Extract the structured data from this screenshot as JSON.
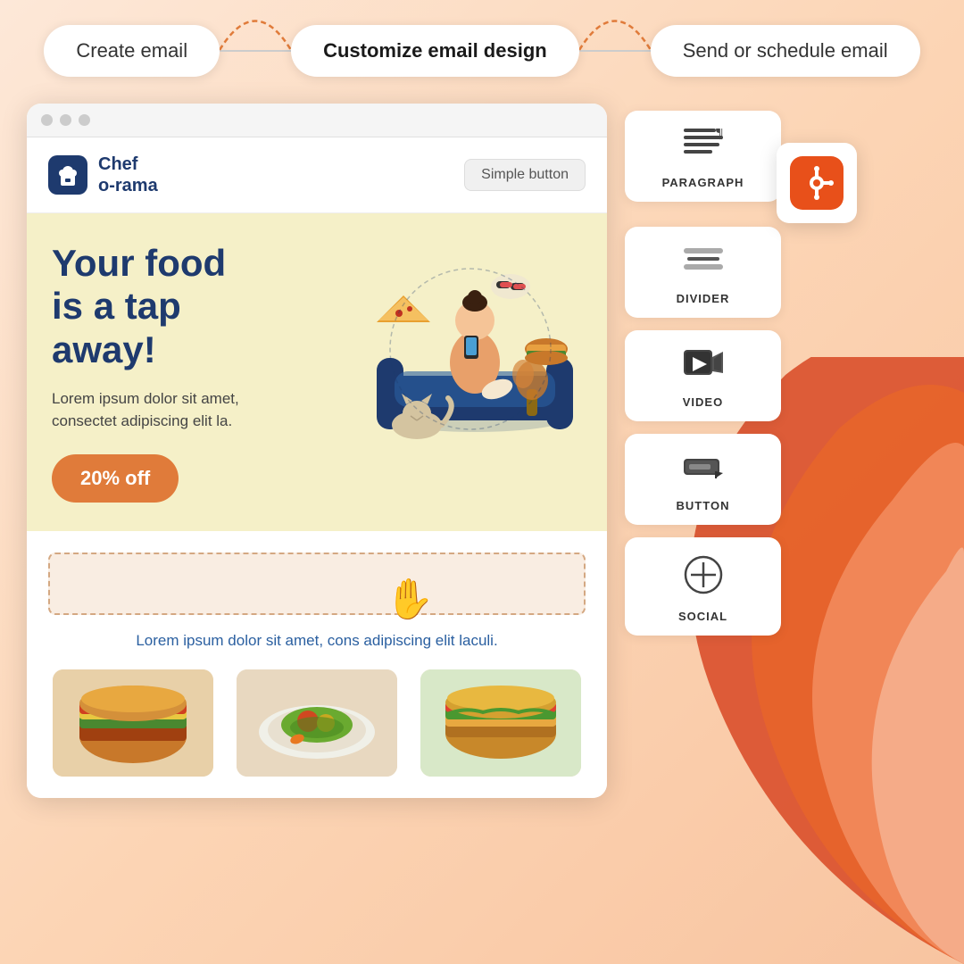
{
  "workflow": {
    "steps": [
      {
        "id": "create",
        "label": "Create email",
        "active": false
      },
      {
        "id": "customize",
        "label": "Customize email design",
        "active": true
      },
      {
        "id": "send",
        "label": "Send or schedule email",
        "active": false
      }
    ]
  },
  "email_preview": {
    "browser_dots": [
      "dot1",
      "dot2",
      "dot3"
    ],
    "brand": {
      "name_line1": "Chef",
      "name_line2": "o-rama"
    },
    "simple_button_label": "Simple button",
    "hero": {
      "title_line1": "Your food",
      "title_line2": "is a tap away!",
      "description": "Lorem ipsum dolor sit amet, consectet adipiscing elit la.",
      "cta_label": "20% off"
    },
    "body": {
      "text": "Lorem ipsum dolor sit amet, cons adipiscing elit laculi."
    }
  },
  "sidebar": {
    "tools": [
      {
        "id": "paragraph",
        "label": "PARAGRAPH",
        "icon": "paragraph"
      },
      {
        "id": "divider",
        "label": "DIVIDER",
        "icon": "divider"
      },
      {
        "id": "video",
        "label": "VIDEO",
        "icon": "video"
      },
      {
        "id": "button",
        "label": "BUTTON",
        "icon": "button"
      },
      {
        "id": "social",
        "label": "SOCIAL",
        "icon": "social"
      }
    ],
    "hubspot": {
      "visible": true
    }
  },
  "colors": {
    "background_gradient_start": "#fde8d8",
    "background_gradient_end": "#f8c4a0",
    "brand_blue": "#1e3a6e",
    "hero_bg": "#f5f0c8",
    "cta_orange": "#e07b3a",
    "accent_orange": "#e8501a",
    "arc_red": "#d94f2b",
    "arc_orange": "#f0825a",
    "arc_peach": "#f5b49a"
  }
}
